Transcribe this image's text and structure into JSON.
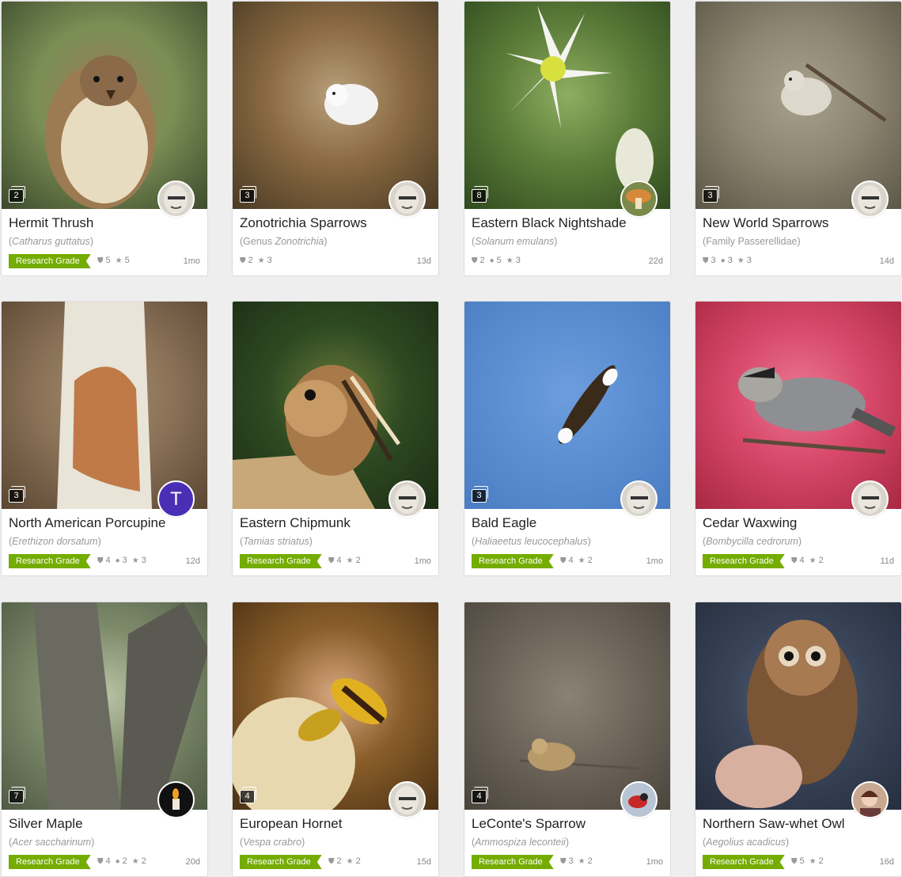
{
  "cards": [
    {
      "name": "Hermit Thrush",
      "sci_pre": "(",
      "sci_italic": "Catharus guttatus",
      "sci_post": ")",
      "research_grade": "Research Grade",
      "photo_count": "2",
      "ids": "5",
      "comments": "",
      "faves": "5",
      "age": "1mo",
      "photo_colors": [
        "#7b8f55",
        "#3c4a2c",
        "#9a7a5a"
      ],
      "subject": "thrush",
      "avatar_kind": "face",
      "avatar_letter": ""
    },
    {
      "name": "Zonotrichia Sparrows",
      "sci_pre": "(Genus ",
      "sci_italic": "Zonotrichia",
      "sci_post": ")",
      "research_grade": "",
      "photo_count": "3",
      "ids": "2",
      "comments": "",
      "faves": "3",
      "age": "13d",
      "photo_colors": [
        "#8a6a42",
        "#4a3a24",
        "#b9a07c"
      ],
      "subject": "white-bird",
      "avatar_kind": "face",
      "avatar_letter": ""
    },
    {
      "name": "Eastern Black Nightshade",
      "sci_pre": "(",
      "sci_italic": "Solanum emulans",
      "sci_post": ")",
      "research_grade": "",
      "photo_count": "8",
      "ids": "2",
      "comments": "5",
      "faves": "3",
      "age": "22d",
      "photo_colors": [
        "#5d7e3a",
        "#2f4a1e",
        "#8fae62"
      ],
      "subject": "flower",
      "avatar_kind": "mushroom",
      "avatar_letter": ""
    },
    {
      "name": "New World Sparrows",
      "sci_pre": "(Family Passerellidae)",
      "sci_italic": "",
      "sci_post": "",
      "research_grade": "",
      "photo_count": "3",
      "ids": "3",
      "comments": "3",
      "faves": "3",
      "age": "14d",
      "photo_colors": [
        "#8d8672",
        "#5c5646",
        "#a8a28c"
      ],
      "subject": "pale-bird",
      "avatar_kind": "face",
      "avatar_letter": ""
    },
    {
      "name": "North American Porcupine",
      "sci_pre": "(",
      "sci_italic": "Erethizon dorsatum",
      "sci_post": ")",
      "research_grade": "Research Grade",
      "photo_count": "3",
      "ids": "4",
      "comments": "3",
      "faves": "3",
      "age": "12d",
      "photo_colors": [
        "#8a7258",
        "#5a4632",
        "#a48a6a"
      ],
      "subject": "trunk-bark",
      "avatar_kind": "letter",
      "avatar_letter": "T"
    },
    {
      "name": "Eastern Chipmunk",
      "sci_pre": "(",
      "sci_italic": "Tamias striatus",
      "sci_post": ")",
      "research_grade": "Research Grade",
      "photo_count": "",
      "ids": "4",
      "comments": "",
      "faves": "2",
      "age": "1mo",
      "photo_colors": [
        "#2e4a22",
        "#1c2c14",
        "#6a7a3a"
      ],
      "subject": "chipmunk",
      "avatar_kind": "face",
      "avatar_letter": ""
    },
    {
      "name": "Bald Eagle",
      "sci_pre": "(",
      "sci_italic": "Haliaeetus leucocephalus",
      "sci_post": ")",
      "research_grade": "Research Grade",
      "photo_count": "3",
      "ids": "4",
      "comments": "",
      "faves": "2",
      "age": "1mo",
      "photo_colors": [
        "#5b8fd2",
        "#4a7cc2",
        "#6d9ddc"
      ],
      "subject": "eagle",
      "avatar_kind": "face",
      "avatar_letter": ""
    },
    {
      "name": "Cedar Waxwing",
      "sci_pre": "(",
      "sci_italic": "Bombycilla cedrorum",
      "sci_post": ")",
      "research_grade": "Research Grade",
      "photo_count": "",
      "ids": "4",
      "comments": "",
      "faves": "2",
      "age": "11d",
      "photo_colors": [
        "#d8486a",
        "#a82842",
        "#e87890"
      ],
      "subject": "waxwing",
      "avatar_kind": "face",
      "avatar_letter": ""
    },
    {
      "name": "Silver Maple",
      "sci_pre": "(",
      "sci_italic": "Acer saccharinum",
      "sci_post": ")",
      "research_grade": "Research Grade",
      "photo_count": "7",
      "ids": "4",
      "comments": "2",
      "faves": "2",
      "age": "20d",
      "photo_colors": [
        "#7d8a6a",
        "#4e5a44",
        "#b8c2a4"
      ],
      "subject": "trees",
      "avatar_kind": "candle",
      "avatar_letter": ""
    },
    {
      "name": "European Hornet",
      "sci_pre": "(",
      "sci_italic": "Vespa crabro",
      "sci_post": ")",
      "research_grade": "Research Grade",
      "photo_count": "4",
      "ids": "2",
      "comments": "",
      "faves": "2",
      "age": "15d",
      "photo_colors": [
        "#8a5e2a",
        "#4a3014",
        "#d8a880"
      ],
      "subject": "hornet",
      "avatar_kind": "face",
      "avatar_letter": ""
    },
    {
      "name": "LeConte's Sparrow",
      "sci_pre": "(",
      "sci_italic": "Ammospiza leconteii",
      "sci_post": ")",
      "research_grade": "Research Grade",
      "photo_count": "4",
      "ids": "3",
      "comments": "",
      "faves": "2",
      "age": "1mo",
      "photo_colors": [
        "#6e665a",
        "#4a443c",
        "#8a8274"
      ],
      "subject": "sparrow",
      "avatar_kind": "bird",
      "avatar_letter": ""
    },
    {
      "name": "Northern Saw-whet Owl",
      "sci_pre": "(",
      "sci_italic": "Aegolius acadicus",
      "sci_post": ")",
      "research_grade": "Research Grade",
      "photo_count": "",
      "ids": "5",
      "comments": "",
      "faves": "2",
      "age": "16d",
      "photo_colors": [
        "#3a4458",
        "#262e3e",
        "#5a6478"
      ],
      "subject": "owl",
      "avatar_kind": "woman",
      "avatar_letter": ""
    }
  ]
}
